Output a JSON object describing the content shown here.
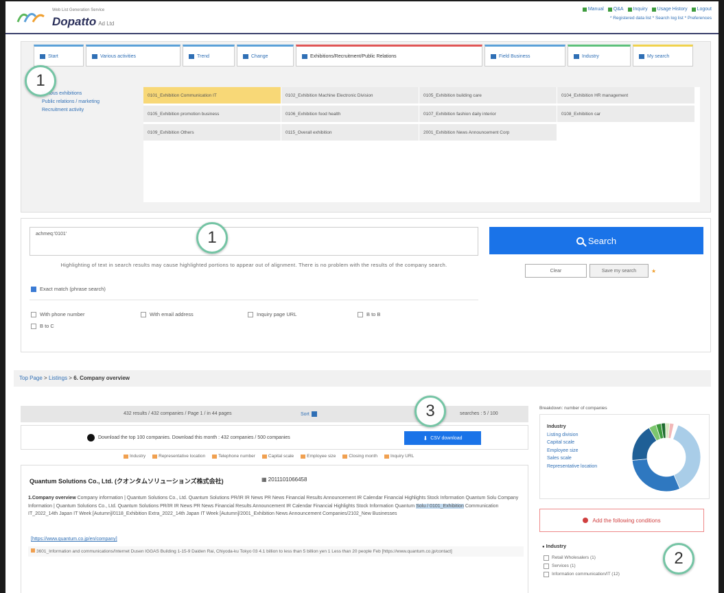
{
  "header": {
    "tagline": "Web List Generation Service",
    "logo_name": "Dopatto",
    "logo_sub": "Ad Ltd",
    "links": [
      "Manual",
      "Q&A",
      "Inquiry",
      "Usage History",
      "Logout"
    ],
    "sublinks": "* Registered data list * Search log list * Preferences"
  },
  "tabs": [
    {
      "label": "Start",
      "icon": "home-icon"
    },
    {
      "label": "Various activities",
      "icon": "grid-icon"
    },
    {
      "label": "Trend",
      "icon": "chart-icon"
    },
    {
      "label": "Change",
      "icon": "chart-icon"
    },
    {
      "label": "Exhibitions/Recruitment/Public Relations",
      "icon": "flag-icon"
    },
    {
      "label": "Field Business",
      "icon": "grid-icon"
    },
    {
      "label": "Industry",
      "icon": "bar-icon"
    },
    {
      "label": "My search",
      "icon": "person-icon"
    }
  ],
  "side_categories": [
    "Various exhibitions",
    "Public relations / marketing",
    "Recruitment activity"
  ],
  "categories": [
    [
      "0101_Exhibition Communication IT",
      "0102_Exhibition Machine Electronic Division",
      "0105_Exhibition building care",
      "0104_Exhibition HR management"
    ],
    [
      "0105_Exhibition promotion business",
      "0106_Exhibition food health",
      "0107_Exhibition fashion daily interior",
      "0108_Exhibition car"
    ],
    [
      "0109_Exhibition Others",
      "0115_Overall exhibition",
      "2001_Exhibition News Announcement Corp",
      ""
    ]
  ],
  "search": {
    "query": "achmeq:'0101'",
    "note": "Highlighting of text in search results may cause highlighted portions to appear out of alignment. There is no problem with the results of the company search.",
    "exact_match": "Exact match (phrase search)",
    "filters": [
      "With phone number",
      "With email address",
      "Inquiry page URL",
      "B to B",
      "B to C"
    ],
    "search_label": "Search",
    "clear_label": "Clear",
    "save_label": "Save my search"
  },
  "breadcrumb": {
    "link1": "Top Page",
    "link2": "Listings",
    "current": "6. Company overview"
  },
  "results": {
    "summary": "432 results / 432 companies / Page 1 / in 44 pages",
    "sort_label": "Sort",
    "right_text": "searches : 5 / 100",
    "download_text": "Download the top 100 companies. Download this month : 432 companies / 500 companies",
    "csv_label": "CSV download",
    "legend": [
      "Industry",
      "Representative location",
      "Telephone number",
      "Capital scale",
      "Employee size",
      "Closing month",
      "Inquiry URL"
    ],
    "company_name": "Quantum Solutions Co., Ltd. (クオンタムソリューションズ株式会社)",
    "company_id": "2011101066458",
    "overview_label": "1.Company overview",
    "overview_a": "Company information | Quantum Solutions Co., Ltd. Quantum Solutions PR/IR IR News PR News Financial Results Announcement IR Calendar Financial Highlights Stock Information Quantum Solu Company Information | Quantum Solutions Co., Ltd. Quantum Solutions PR/IR IR News PR News Financial Results Announcement IR Calendar Financial Highlights Stock Information Quantum ",
    "overview_hl": "Solu / 0101_Exhibition",
    "overview_b": " Communication IT_2022_14th Japan IT Week [Autumn]/0118_Exhibition Extra_2022_14th Japan IT Week [Autumn]/2001_Exhibition News Announcement Companies/2102_New Businesses",
    "company_url": "[https://www.quantum.co.jp/en/company]",
    "tags": "3601_Information and communications/Internet  Dusen IGGAS Building 1-15-9 Daiden Rai, Chiyoda-ku Tokyo  03  4.1 billion to less than 5 billion yen  1 Less than 20 people  Feb  [https://www.quantum.co.jp/contact]"
  },
  "sidebar": {
    "title": "Breakdown: number of companies",
    "links_head": "Industry",
    "links": [
      "Listing division",
      "Capital scale",
      "Employee size",
      "Sales scale",
      "Representative location"
    ],
    "add_conditions": "Add the following conditions",
    "industry_title": "Industry",
    "industry_list": [
      "Retail Wholesalers (1)",
      "Services (1)",
      "Information communication/IT (12)"
    ]
  },
  "annotations": [
    "1",
    "1",
    "3",
    "2"
  ],
  "colors": {
    "accent": "#1a73e8",
    "tab_active_highlight": "#f8d877",
    "donut": [
      "#a9cde8",
      "#2f78c0",
      "#1f5f96",
      "#7cc66e",
      "#3d9b3d",
      "#1e6b2e",
      "#d8e8c0",
      "#f2b8b8"
    ]
  },
  "donut_values": [
    0.38,
    0.3,
    0.18,
    0.035,
    0.025,
    0.02,
    0.02,
    0.02
  ]
}
